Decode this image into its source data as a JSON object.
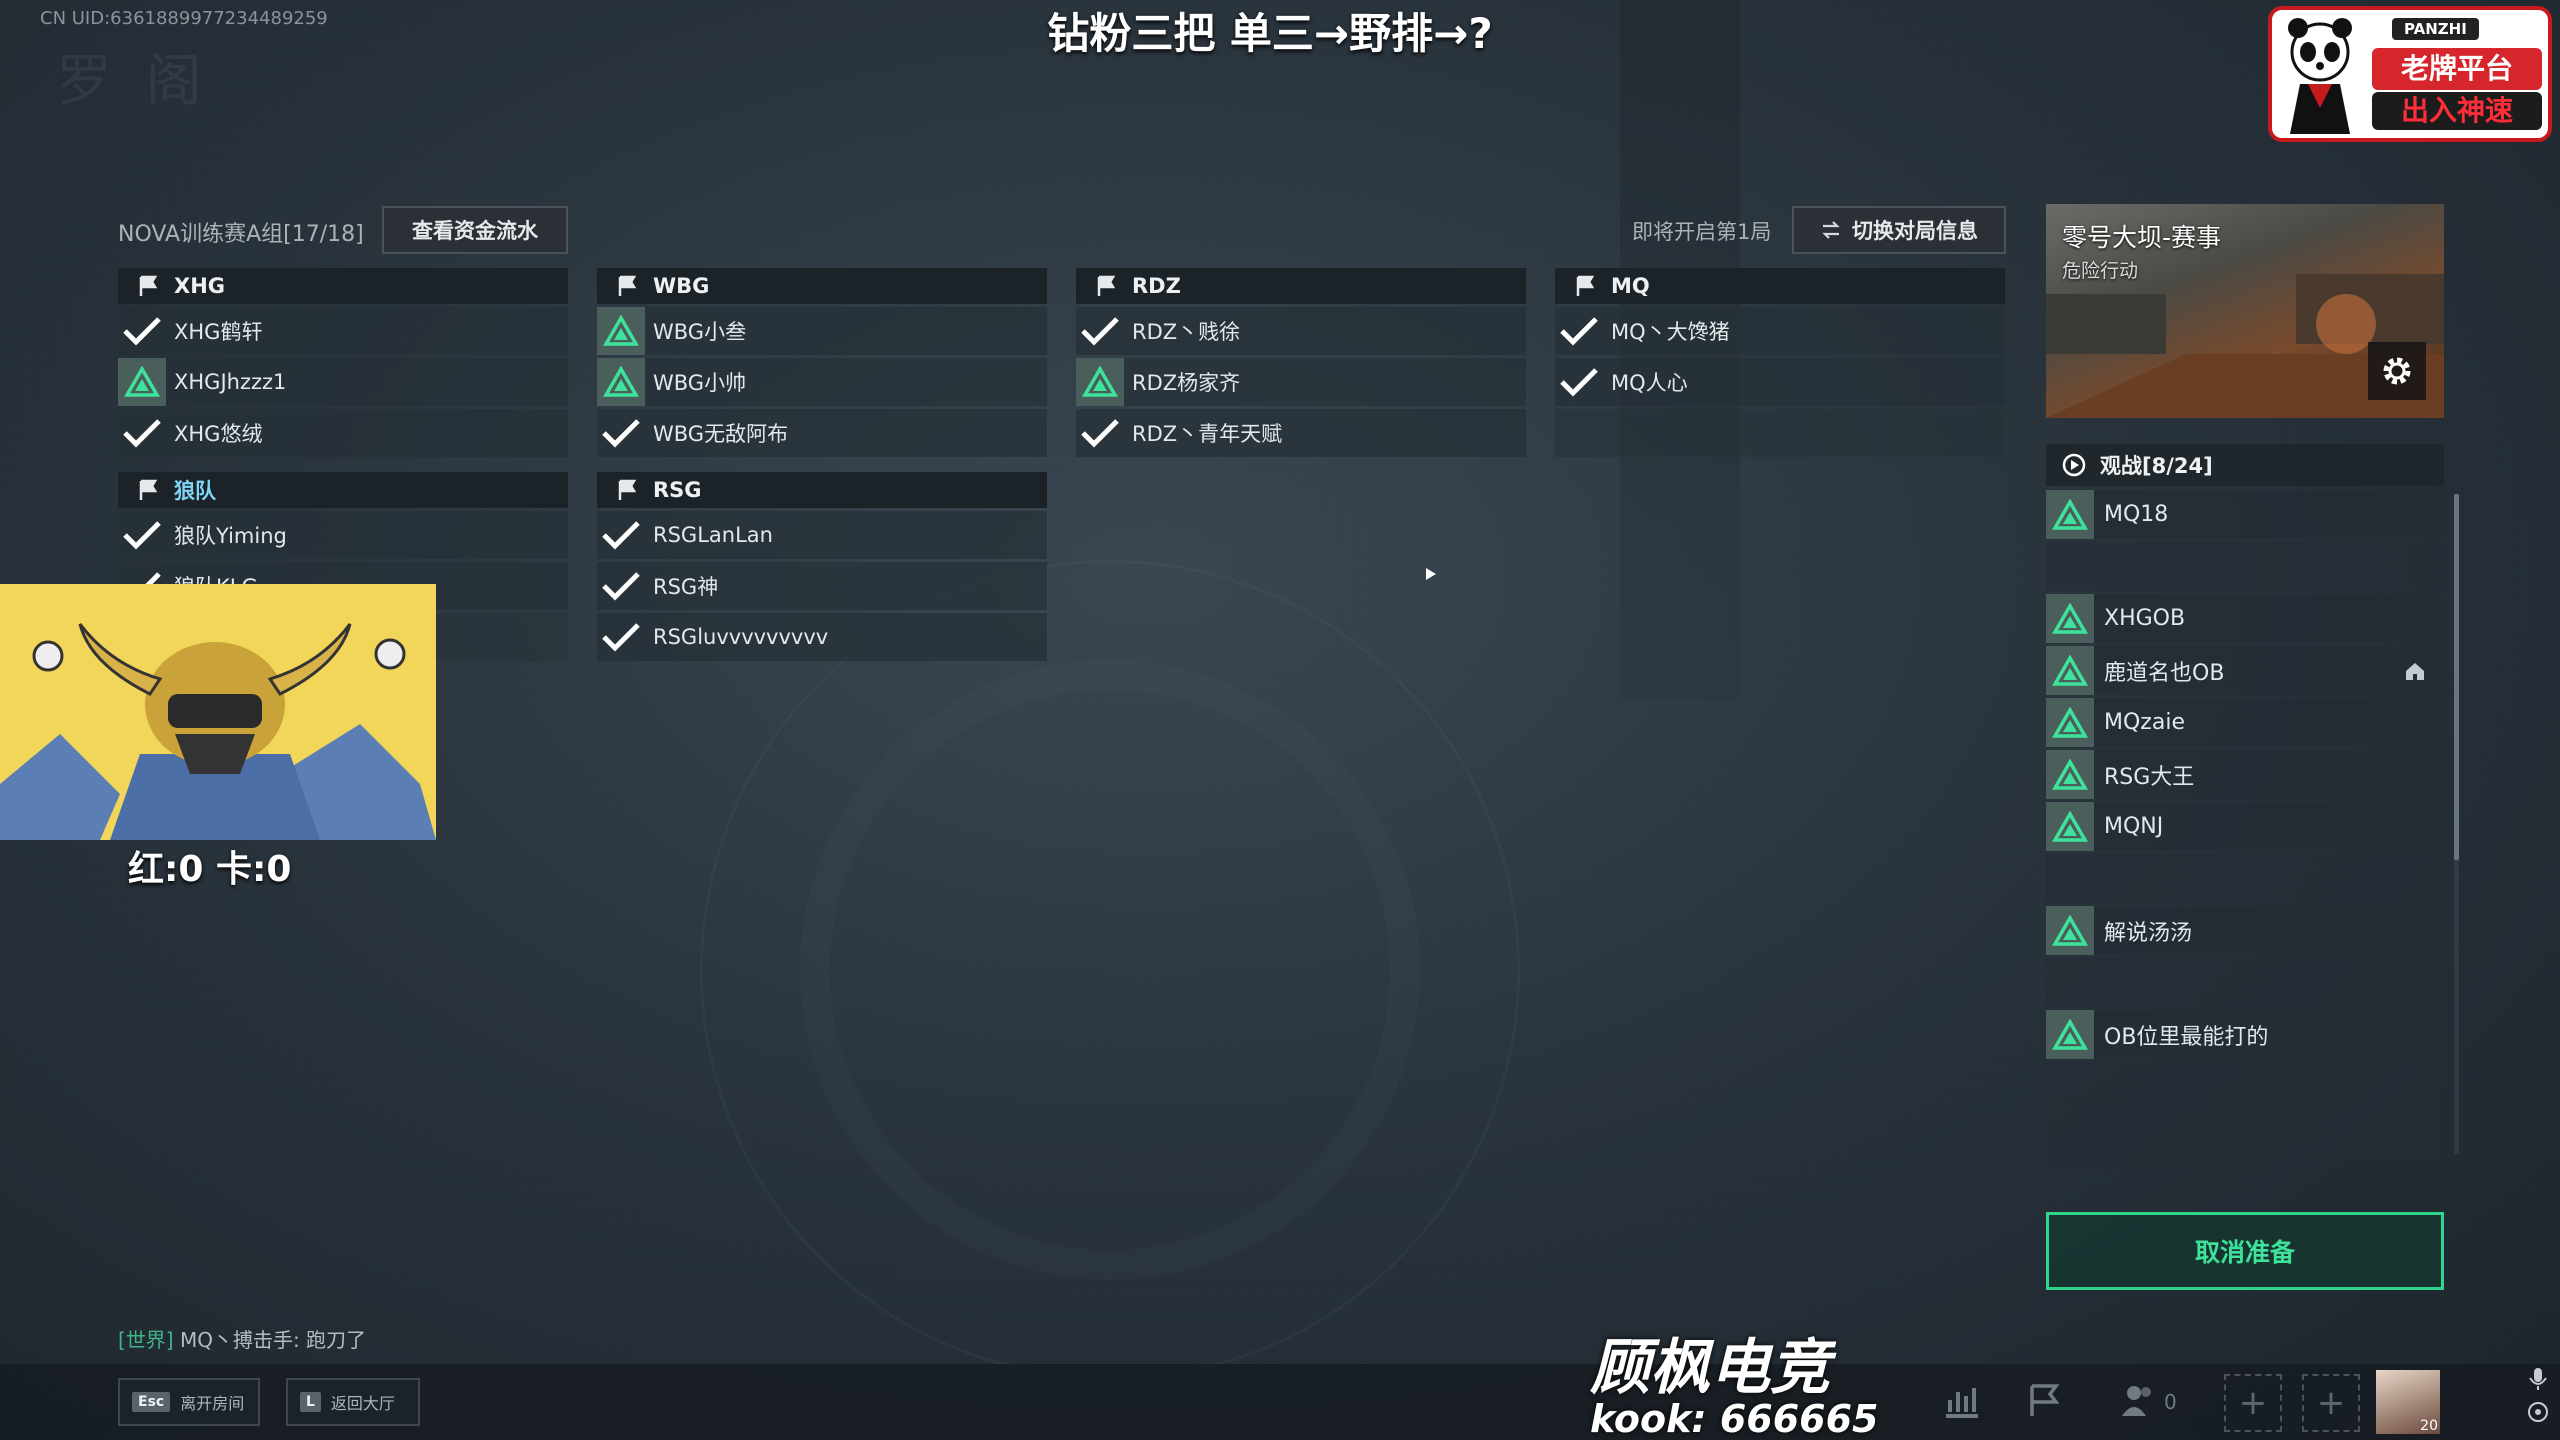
{
  "uid_text": "CN UID:6361889977234489259",
  "watermark": "罗  阁",
  "overlay_title": "钻粉三把 单三→野排→?",
  "panzhi": {
    "top": "PANZHI",
    "line1": "老牌平台",
    "line2": "出入神速"
  },
  "room": {
    "label": "NOVA训练赛A组[17/18]",
    "funds_button": "查看资金流水"
  },
  "round": {
    "upcoming": "即将开启第1局",
    "switch_button": "切换对局信息"
  },
  "teams": [
    {
      "name": "XHG",
      "highlight": false,
      "players": [
        {
          "name": "XHG鹤轩",
          "status": "ready"
        },
        {
          "name": "XHGJhzzz1",
          "status": "tri"
        },
        {
          "name": "XHG悠绒",
          "status": "ready"
        }
      ]
    },
    {
      "name": "WBG",
      "highlight": false,
      "players": [
        {
          "name": "WBG小叁",
          "status": "tri"
        },
        {
          "name": "WBG小帅",
          "status": "tri"
        },
        {
          "name": "WBG无敌阿布",
          "status": "ready"
        }
      ]
    },
    {
      "name": "RDZ",
      "highlight": false,
      "players": [
        {
          "name": "RDZ丶贱徐",
          "status": "ready"
        },
        {
          "name": "RDZ杨家齐",
          "status": "tri"
        },
        {
          "name": "RDZ丶青年天赋",
          "status": "ready"
        }
      ]
    },
    {
      "name": "MQ",
      "highlight": false,
      "players": [
        {
          "name": "MQ丶大馋猪",
          "status": "ready"
        },
        {
          "name": "MQ人心",
          "status": "ready"
        },
        {
          "name": "",
          "status": "empty"
        }
      ]
    },
    {
      "name": "狼队",
      "highlight": true,
      "players": [
        {
          "name": "狼队Yiming",
          "status": "ready"
        },
        {
          "name": "狼队KLG",
          "status": "ready"
        },
        {
          "name": "",
          "status": "empty"
        }
      ]
    },
    {
      "name": "RSG",
      "highlight": false,
      "players": [
        {
          "name": "RSGLanLan",
          "status": "ready"
        },
        {
          "name": "RSG神",
          "status": "ready"
        },
        {
          "name": "RSGluvvvvvvvvv",
          "status": "ready"
        }
      ]
    }
  ],
  "webcam": {
    "score": "红:0 卡:0"
  },
  "map": {
    "name": "零号大坝-赛事",
    "mode": "危险行动"
  },
  "spectate": {
    "header": "观战[8/24]",
    "slots": [
      {
        "name": "MQ18"
      },
      {
        "name": ""
      },
      {
        "name": "XHGOB"
      },
      {
        "name": "鹿道名也OB",
        "home": true
      },
      {
        "name": "MQzaie"
      },
      {
        "name": "RSG大王"
      },
      {
        "name": "MQNJ"
      },
      {
        "name": ""
      },
      {
        "name": "解说汤汤"
      },
      {
        "name": ""
      },
      {
        "name": "OB位里最能打的"
      },
      {
        "name": ""
      },
      {
        "name": ""
      }
    ]
  },
  "cancel_ready": "取消准备",
  "chat": {
    "channel": "[世界]",
    "message": " MQ丶搏击手: 跑刀了"
  },
  "bottom": {
    "leave_key": "Esc",
    "leave_label": "离开房间",
    "lobby_key": "L",
    "lobby_label": "返回大厅",
    "people_count": "0",
    "avatar_level": "20"
  },
  "brand": {
    "line1": "顾枫电竞",
    "line2": "kook: 666665"
  },
  "colors": {
    "accent_green": "#2fd58a",
    "ready_check": "#ffffff",
    "tri_green": "#3ee29a",
    "highlight_team": "#7fd3f5"
  }
}
